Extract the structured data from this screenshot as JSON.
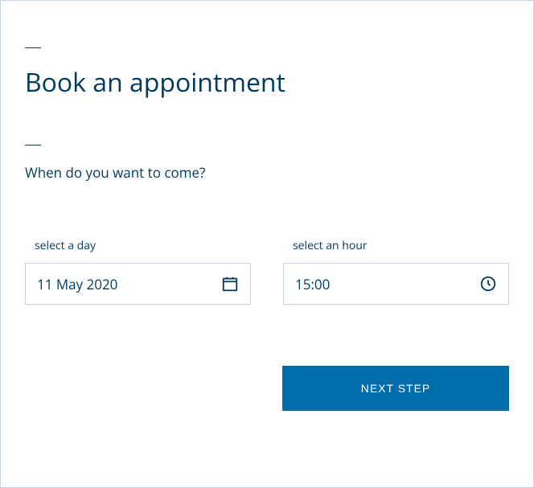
{
  "title": "Book an appointment",
  "subtitle": "When do you want to come?",
  "fields": {
    "day": {
      "label": "select a day",
      "value": "11 May 2020"
    },
    "hour": {
      "label": "select an hour",
      "value": "15:00"
    }
  },
  "actions": {
    "next": "NEXT STEP"
  },
  "colors": {
    "primary": "#003a5d",
    "accent": "#006eab",
    "border": "#c5d6e0"
  }
}
